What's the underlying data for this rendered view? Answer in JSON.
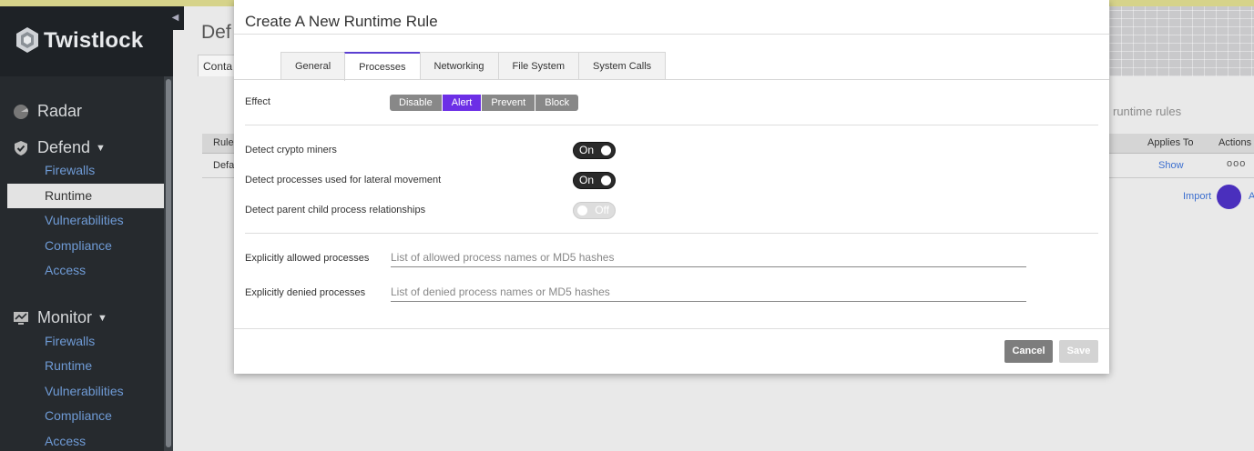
{
  "brand": {
    "name": "Twistlock"
  },
  "sidebar": {
    "sections": [
      {
        "label": "Radar",
        "icon": "radar-icon"
      },
      {
        "label": "Defend",
        "icon": "shield-icon",
        "items": [
          "Firewalls",
          "Runtime",
          "Vulnerabilities",
          "Compliance",
          "Access"
        ]
      },
      {
        "label": "Monitor",
        "icon": "monitor-icon",
        "items": [
          "Firewalls",
          "Runtime",
          "Vulnerabilities",
          "Compliance",
          "Access"
        ]
      }
    ],
    "active_item": "Runtime"
  },
  "background": {
    "page_title": "Def",
    "tab": "Conta",
    "search_hint": "runtime rules",
    "table": {
      "rule_header": "Rule",
      "applies_header": "Applies To",
      "actions_header": "Actions",
      "row_name": "Defa",
      "show_link": "Show",
      "actions_glyph": "ooo"
    },
    "import_link": "Import",
    "edge_letter": "A"
  },
  "modal": {
    "title": "Create A New Runtime Rule",
    "tabs": [
      "General",
      "Processes",
      "Networking",
      "File System",
      "System Calls"
    ],
    "active_tab": "Processes",
    "effect": {
      "label": "Effect",
      "options": [
        "Disable",
        "Alert",
        "Prevent",
        "Block"
      ],
      "selected": "Alert"
    },
    "toggles": [
      {
        "label": "Detect crypto miners",
        "state": "On"
      },
      {
        "label": "Detect processes used for lateral movement",
        "state": "On"
      },
      {
        "label": "Detect parent child process relationships",
        "state": "Off"
      }
    ],
    "allowed": {
      "label": "Explicitly allowed processes",
      "placeholder": "List of allowed process names or MD5 hashes",
      "value": ""
    },
    "denied": {
      "label": "Explicitly denied processes",
      "placeholder": "List of denied process names or MD5 hashes",
      "value": ""
    },
    "buttons": {
      "cancel": "Cancel",
      "save": "Save"
    }
  },
  "colors": {
    "accent": "#6c2fe6",
    "sidebar_bg": "#262a2e",
    "nav_link": "#6f9bd6"
  }
}
